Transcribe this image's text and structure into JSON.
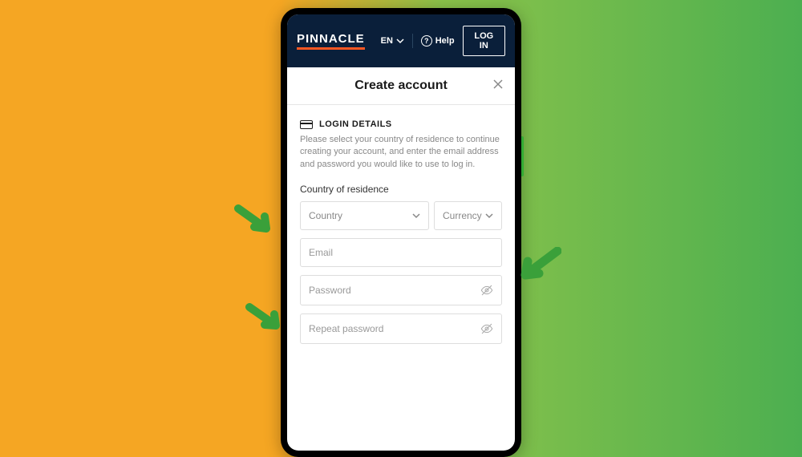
{
  "header": {
    "logo": "PINNACLE",
    "language": "EN",
    "help_label": "Help",
    "login_label": "LOG IN"
  },
  "page": {
    "title": "Create account"
  },
  "section": {
    "title": "LOGIN DETAILS",
    "description": "Please select your country of residence to continue creating your account, and enter the email address and password you would like to use to log in."
  },
  "fields": {
    "country_label": "Country of residence",
    "country_select": "Country",
    "currency_select": "Currency",
    "email_placeholder": "Email",
    "password_placeholder": "Password",
    "repeat_password_placeholder": "Repeat password"
  },
  "colors": {
    "accent": "#ff5722",
    "header_bg": "#0a1f3a",
    "arrow": "#3aa03a"
  }
}
